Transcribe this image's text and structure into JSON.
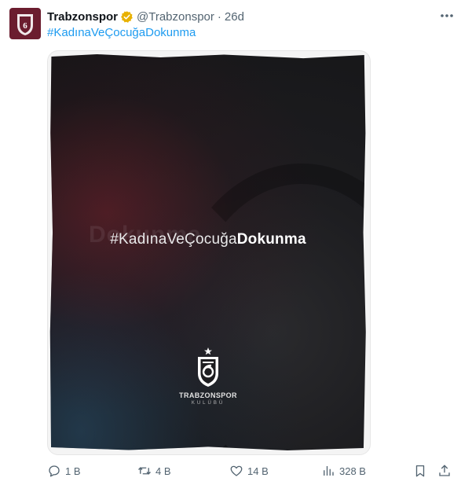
{
  "tweet": {
    "author_name": "Trabzonspor",
    "handle": "@Trabzonspor",
    "separator": "·",
    "time": "26d",
    "text": "#KadınaVeÇocuğaDokunma",
    "media": {
      "ghost_word": "Dokunma",
      "hashtag_light": "#KadınaVeÇocuğa",
      "hashtag_bold": "Dokunma",
      "club_name": "TRABZONSPOR",
      "club_subtitle": "KULÜBÜ"
    },
    "actions": {
      "replies": "1 B",
      "retweets": "4 B",
      "likes": "14 B",
      "views": "328 B"
    }
  },
  "colors": {
    "brand": "#6b1d2f",
    "link": "#1d9bf0",
    "muted": "#536471",
    "verified_gold": "#e8b100"
  },
  "icons": [
    "more-icon",
    "verified-icon",
    "reply-icon",
    "retweet-icon",
    "like-icon",
    "views-icon",
    "bookmark-icon",
    "share-icon",
    "club-crest-icon"
  ]
}
